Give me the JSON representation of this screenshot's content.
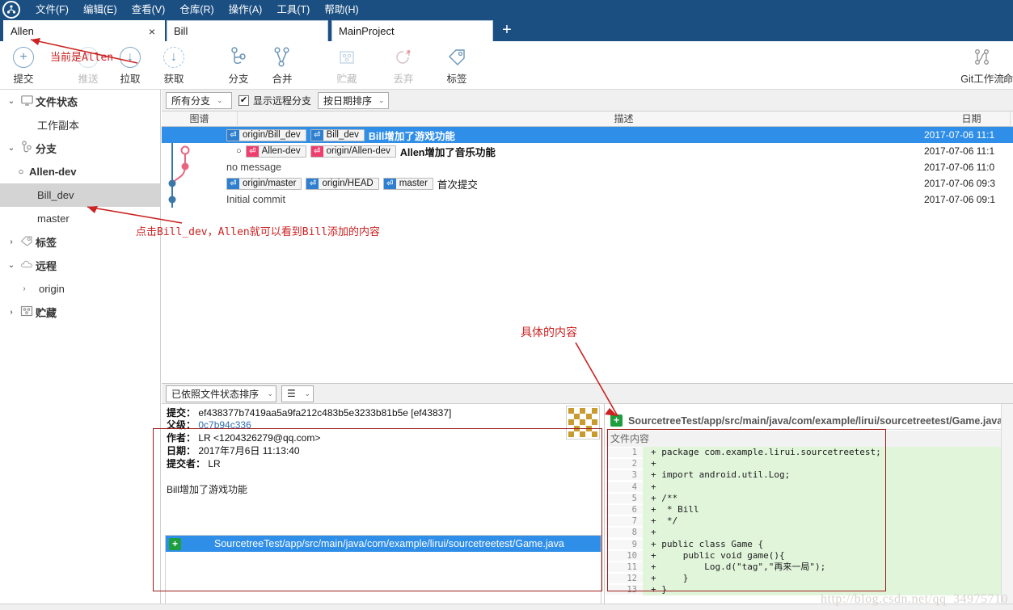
{
  "app": {
    "logo_icon": "sourcetree-logo-icon",
    "menus": [
      {
        "label": "文件(F)"
      },
      {
        "label": "编辑(E)"
      },
      {
        "label": "查看(V)"
      },
      {
        "label": "仓库(R)"
      },
      {
        "label": "操作(A)"
      },
      {
        "label": "工具(T)"
      },
      {
        "label": "帮助(H)"
      }
    ]
  },
  "tabs": {
    "items": [
      {
        "label": "Allen",
        "active": true,
        "close": "×"
      },
      {
        "label": "Bill",
        "active": false
      },
      {
        "label": "MainProject",
        "active": false
      }
    ],
    "add_label": "+"
  },
  "toolbar": {
    "buttons": [
      {
        "label": "提交",
        "icon": "commit-plus-icon",
        "glyph": "+",
        "enabled": true
      },
      {
        "label": "推送",
        "icon": "push-up-arrow-icon",
        "glyph": "↑",
        "enabled": false
      },
      {
        "label": "拉取",
        "icon": "pull-down-arrow-icon",
        "glyph": "↓",
        "enabled": true
      },
      {
        "label": "获取",
        "icon": "fetch-dashed-arrow-icon",
        "glyph": "↓",
        "enabled": true
      },
      {
        "label": "分支",
        "icon": "branch-icon",
        "enabled": true
      },
      {
        "label": "合并",
        "icon": "merge-icon",
        "enabled": true
      },
      {
        "label": "贮藏",
        "icon": "stash-icon",
        "enabled": false
      },
      {
        "label": "丢弃",
        "icon": "discard-reset-icon",
        "enabled": false
      },
      {
        "label": "标签",
        "icon": "tag-icon",
        "enabled": true
      }
    ],
    "right": [
      {
        "label": "Git工作流",
        "icon": "git-flow-icon"
      },
      {
        "label": "命",
        "icon": "terminal-icon"
      }
    ]
  },
  "sidebar": {
    "items": [
      {
        "label": "文件状态",
        "icon": "monitor-icon",
        "arrow": "⌄",
        "level": "group",
        "selected": false
      },
      {
        "label": "工作副本",
        "icon": "",
        "arrow": "",
        "level": "child",
        "selected": false
      },
      {
        "label": "分支",
        "icon": "branch-icon",
        "arrow": "⌄",
        "level": "group",
        "selected": false
      },
      {
        "label": "Allen-dev",
        "icon": "",
        "arrow": "",
        "level": "branch-current",
        "bullet": "○",
        "selected": false
      },
      {
        "label": "Bill_dev",
        "icon": "",
        "arrow": "",
        "level": "branch",
        "selected": true
      },
      {
        "label": "master",
        "icon": "",
        "arrow": "",
        "level": "branch",
        "selected": false
      },
      {
        "label": "标签",
        "icon": "tag-icon",
        "arrow": "›",
        "level": "group",
        "selected": false
      },
      {
        "label": "远程",
        "icon": "cloud-icon",
        "arrow": "⌄",
        "level": "group",
        "selected": false
      },
      {
        "label": "origin",
        "icon": "",
        "arrow": "›",
        "level": "remote-child",
        "selected": false
      },
      {
        "label": "贮藏",
        "icon": "stash-icon",
        "arrow": "›",
        "level": "group",
        "selected": false
      }
    ]
  },
  "filterbar": {
    "branch_select": "所有分支",
    "show_remote_label": "显示远程分支",
    "show_remote_checked": true,
    "sort_select": "按日期排序",
    "caret": "⌄",
    "check_glyph": "✔"
  },
  "commit_table": {
    "headers": {
      "graph": "图谱",
      "description": "描述",
      "date": "日期"
    },
    "rows": [
      {
        "refs": [
          {
            "name": "origin/Bill_dev",
            "color": "blue"
          },
          {
            "name": "Bill_dev",
            "color": "blue"
          }
        ],
        "message": "Bill增加了游戏功能",
        "date": "2017-07-06 11:1",
        "selected": true,
        "bold": true
      },
      {
        "refs": [
          {
            "name": "Allen-dev",
            "color": "pink"
          },
          {
            "name": "origin/Allen-dev",
            "color": "pink"
          }
        ],
        "message": "Allen增加了音乐功能",
        "date": "2017-07-06 11:1",
        "selected": false,
        "bold": true,
        "leading_bullet": "○"
      },
      {
        "refs": [],
        "message": "no message",
        "date": "2017-07-06 11:0",
        "selected": false,
        "bold": false
      },
      {
        "refs": [
          {
            "name": "origin/master",
            "color": "blue"
          },
          {
            "name": "origin/HEAD",
            "color": "blue"
          },
          {
            "name": "master",
            "color": "blue"
          }
        ],
        "message": "首次提交",
        "date": "2017-07-06 09:3",
        "selected": false,
        "bold": false
      },
      {
        "refs": [],
        "message": "Initial commit",
        "date": "2017-07-06 09:1",
        "selected": false,
        "bold": false
      }
    ]
  },
  "detail_toolbar": {
    "sort_select": "已依照文件状态排序",
    "view_mode_icon": "list-view-icon",
    "caret": "⌄"
  },
  "commit_detail": {
    "commit_label": "提交：",
    "commit_hash": "ef438377b7419aa5a9fa212c483b5e3233b81b5e [ef43837]",
    "parent_label": "父级：",
    "parent_hash": "0c7b94c336",
    "author_label": "作者：",
    "author_value": "LR <1204326279@qq.com>",
    "date_label": "日期：",
    "date_value": "2017年7月6日 11:13:40",
    "committer_label": "提交者：",
    "committer_value": "LR",
    "message": "Bill增加了游戏功能",
    "avatar_icon": "identicon-avatar",
    "files": [
      {
        "badge": "+",
        "path": "SourcetreeTest/app/src/main/java/com/example/lirui/sourcetreetest/Game.java",
        "selected": true
      }
    ]
  },
  "diff": {
    "badge": "+",
    "file_title": "SourcetreeTest/app/src/main/java/com/example/lirui/sourcetreetest/Game.java",
    "section_label": "文件内容",
    "lines": [
      {
        "n": "1",
        "text": "+ package com.example.lirui.sourcetreetest;"
      },
      {
        "n": "2",
        "text": "+ "
      },
      {
        "n": "3",
        "text": "+ import android.util.Log;"
      },
      {
        "n": "4",
        "text": "+ "
      },
      {
        "n": "5",
        "text": "+ /**"
      },
      {
        "n": "6",
        "text": "+  * Bill"
      },
      {
        "n": "7",
        "text": "+  */"
      },
      {
        "n": "8",
        "text": "+ "
      },
      {
        "n": "9",
        "text": "+ public class Game {"
      },
      {
        "n": "10",
        "text": "+     public void game(){"
      },
      {
        "n": "11",
        "text": "+         Log.d(\"tag\",\"再来一局\");"
      },
      {
        "n": "12",
        "text": "+     }"
      },
      {
        "n": "13",
        "text": "+ }"
      }
    ]
  },
  "annotations": [
    {
      "id": "anno-current-allen",
      "text": "当前是Allen"
    },
    {
      "id": "anno-click-bill-dev",
      "text": "点击Bill_dev，Allen就可以看到Bill添加的内容"
    },
    {
      "id": "anno-specific-content",
      "text": "具体的内容"
    }
  ],
  "watermark": {
    "text": "http://blog.csdn.net/qq_34975710"
  },
  "colors": {
    "title_bar": "#1b4f82",
    "selection": "#2f8ee8",
    "branch_blue": "#2f7fd0",
    "branch_pink": "#ef3e6e",
    "diff_add_bg": "#e1f5db",
    "annotation_red": "#cc2222"
  }
}
